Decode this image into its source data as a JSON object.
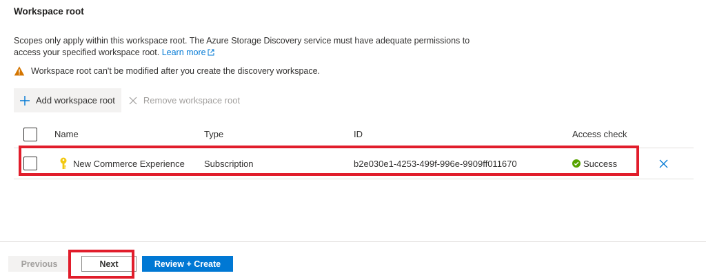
{
  "section": {
    "title": "Workspace root"
  },
  "description": {
    "text": "Scopes only apply within this workspace root. The Azure Storage Discovery service must have adequate permissions to access your specified workspace root.",
    "link_label": "Learn more"
  },
  "warning": {
    "text": "Workspace root can't be modified after you create the discovery workspace."
  },
  "toolbar": {
    "add_label": "Add workspace root",
    "remove_label": "Remove workspace root"
  },
  "table": {
    "columns": {
      "name": "Name",
      "type": "Type",
      "id": "ID",
      "access": "Access check"
    },
    "rows": [
      {
        "name": "New Commerce Experience",
        "type": "Subscription",
        "id": "b2e030e1-4253-499f-996e-9909ff011670",
        "access": "Success"
      }
    ]
  },
  "footer": {
    "previous_label": "Previous",
    "next_label": "Next",
    "create_label": "Review + Create"
  },
  "colors": {
    "accent": "#0078d4",
    "success": "#57a300",
    "warning": "#d47500",
    "key": "#f2c811",
    "highlight": "#e11d2b"
  }
}
